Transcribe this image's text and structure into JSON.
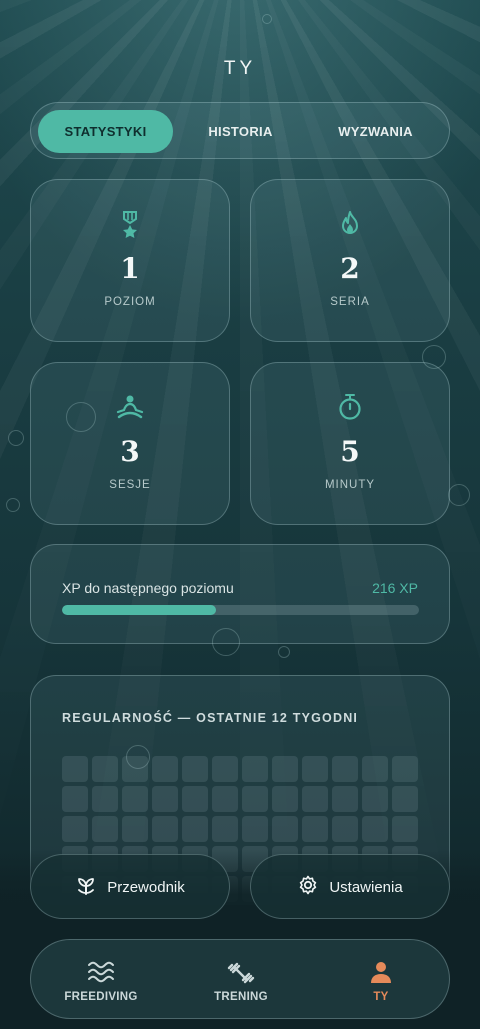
{
  "page_title": "TY",
  "tabs": [
    {
      "label": "STATYSTYKI",
      "active": true
    },
    {
      "label": "HISTORIA",
      "active": false
    },
    {
      "label": "WYZWANIA",
      "active": false
    }
  ],
  "stats": [
    {
      "icon": "medal-icon",
      "value": "1",
      "label": "POZIOM"
    },
    {
      "icon": "flame-icon",
      "value": "2",
      "label": "SERIA"
    },
    {
      "icon": "meditation-icon",
      "value": "3",
      "label": "SESJE"
    },
    {
      "icon": "stopwatch-icon",
      "value": "5",
      "label": "MINUTY"
    }
  ],
  "xp": {
    "label": "XP do następnego poziomu",
    "value": "216 XP",
    "progress": 0.43
  },
  "regularity": {
    "title": "REGULARNOŚĆ — OSTATNIE 12 TYGODNI",
    "weeks": 12
  },
  "actions": [
    {
      "icon": "sprout-icon",
      "label": "Przewodnik"
    },
    {
      "icon": "gear-icon",
      "label": "Ustawienia"
    }
  ],
  "nav": [
    {
      "icon": "waves-icon",
      "label": "FREEDIVING",
      "active": false
    },
    {
      "icon": "dumbbell-icon",
      "label": "TRENING",
      "active": false
    },
    {
      "icon": "person-icon",
      "label": "TY",
      "active": true
    }
  ],
  "colors": {
    "accent": "#4fb9a5",
    "nav_active": "#e58a5a",
    "background": "#1a3e43"
  }
}
